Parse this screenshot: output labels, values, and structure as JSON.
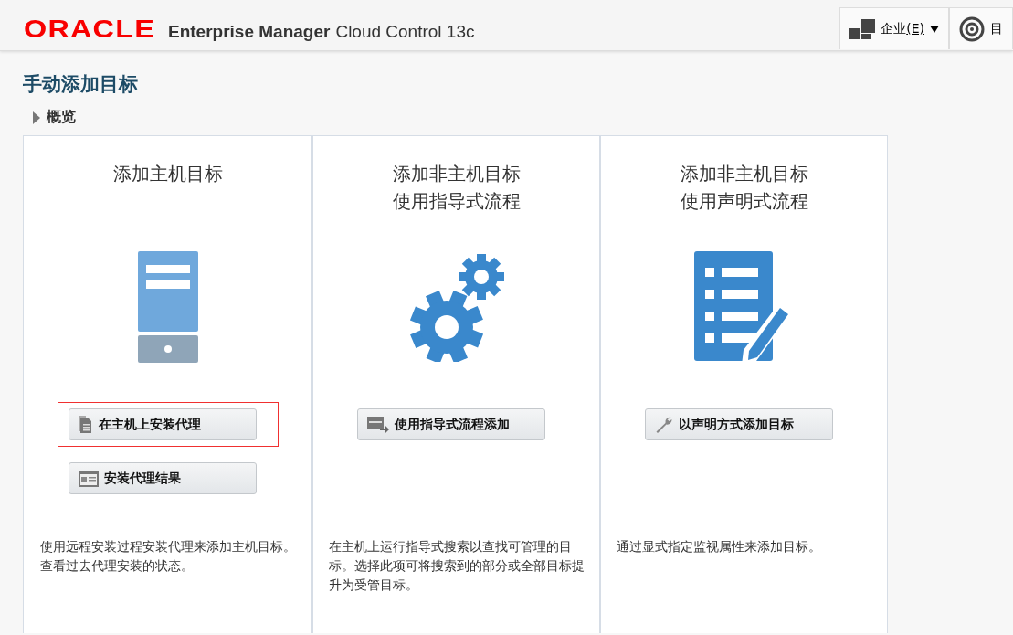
{
  "header": {
    "logo": "ORACLE",
    "product_bold": "Enterprise Manager",
    "product_rest": "Cloud Control 13c",
    "menus": [
      {
        "label": "企业",
        "accelerator": "(E)",
        "kind": "enterprise",
        "has_caret": true
      },
      {
        "label": "目",
        "kind": "targets",
        "has_caret": false
      }
    ]
  },
  "page_title": "手动添加目标",
  "overview": {
    "label": "概览",
    "expanded": false
  },
  "cards": [
    {
      "title_lines": [
        "添加主机目标"
      ],
      "kind": "server",
      "buttons": [
        {
          "label": "在主机上安装代理",
          "highlighted": true
        },
        {
          "label": "安装代理结果",
          "highlighted": false
        }
      ],
      "description": "使用远程安装过程安装代理来添加主机目标。查看过去代理安装的状态。"
    },
    {
      "title_lines": [
        "添加非主机目标",
        "使用指导式流程"
      ],
      "kind": "gears",
      "buttons": [
        {
          "label": "使用指导式流程添加",
          "highlighted": false
        }
      ],
      "description": "在主机上运行指导式搜索以查找可管理的目标。选择此项可将搜索到的部分或全部目标提升为受管目标。"
    },
    {
      "title_lines": [
        "添加非主机目标",
        "使用声明式流程"
      ],
      "kind": "form",
      "buttons": [
        {
          "label": "以声明方式添加目标",
          "highlighted": false
        }
      ],
      "description": "通过显式指定监视属性来添加目标。"
    }
  ]
}
